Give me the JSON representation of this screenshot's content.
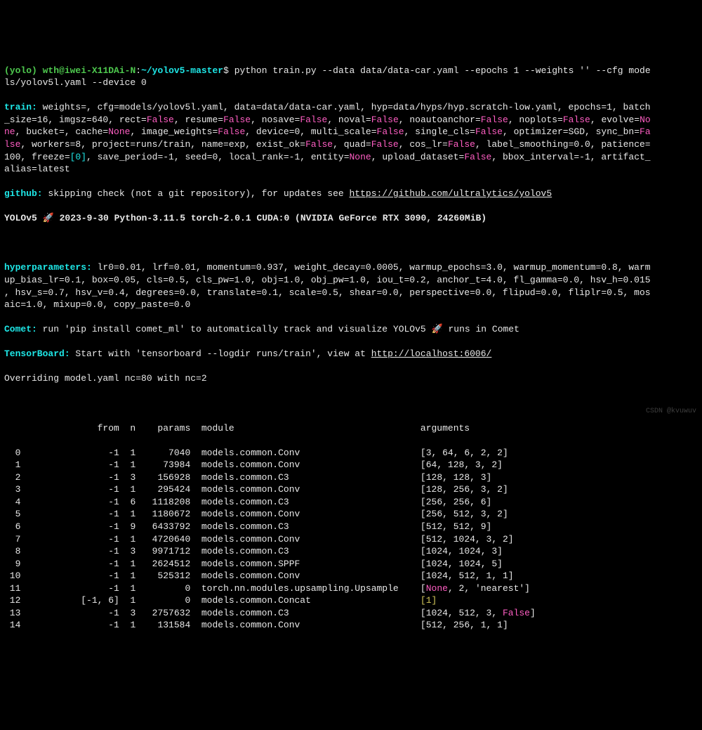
{
  "prompt": {
    "env": "(yolo)",
    "userhost": "wth@iwei-X11DAi-N",
    "path": "~/yolov5-master",
    "dollar": "$",
    "cmd": "python train.py --data data/data-car.yaml --epochs 1 --weights '' --cfg mode\nls/yolov5l.yaml --device 0"
  },
  "train_label": "train:",
  "train_line1": " weights=, cfg=models/yolov5l.yaml, data=data/data-car.yaml, hyp=data/hyps/hyp.scratch-low.yaml, epochs=1, batch\n_size=16, imgsz=640, rect=",
  "false": "False",
  "none": "None",
  "train_resume": ", resume=",
  "train_nosave": ", nosave=",
  "train_noval": ", noval=",
  "train_noauto": ", noautoanchor=",
  "train_noplots": ", noplots=",
  "train_evolve": ", evolve=",
  "train_no": "No",
  "train_ne": "ne",
  "train_bucket": ", bucket=, cache=",
  "train_imgw": ", image_weights=",
  "train_dev": ", device=0, multi_scale=",
  "train_single": ", single_cls=",
  "train_opt": ", optimizer=SGD, sync_bn=",
  "train_fa": "Fa",
  "train_lse": "lse",
  "train_workers": ", workers=8, project=runs/train, name=exp, exist_ok=",
  "train_quad": ", quad=",
  "train_cos": ", cos_lr=",
  "train_label_sm": ", label_smoothing=0.0, patience=\n100, freeze=",
  "train_freeze_val": "[0]",
  "train_save": ", save_period=-1, seed=0, local_rank=-1, entity=",
  "train_upload": ", upload_dataset=",
  "train_bbox": ", bbox_interval=-1, artifact_\nalias=latest",
  "github_label": "github:",
  "github_text": " skipping check (not a git repository), for updates see ",
  "github_url": "https://github.com/ultralytics/yolov5",
  "yolov5_line": "YOLOv5 🚀 2023-9-30 Python-3.11.5 torch-2.0.1 CUDA:0 (NVIDIA GeForce RTX 3090, 24260MiB)",
  "hyper_label": "hyperparameters:",
  "hyper_text": " lr0=0.01, lrf=0.01, momentum=0.937, weight_decay=0.0005, warmup_epochs=3.0, warmup_momentum=0.8, warm\nup_bias_lr=0.1, box=0.05, cls=0.5, cls_pw=1.0, obj=1.0, obj_pw=1.0, iou_t=0.2, anchor_t=4.0, fl_gamma=0.0, hsv_h=0.015\n, hsv_s=0.7, hsv_v=0.4, degrees=0.0, translate=0.1, scale=0.5, shear=0.0, perspective=0.0, flipud=0.0, fliplr=0.5, mos\naic=1.0, mixup=0.0, copy_paste=0.0",
  "comet_label": "Comet:",
  "comet_text": " run 'pip install comet_ml' to automatically track and visualize YOLOv5 🚀 runs in Comet",
  "tb_label": "TensorBoard:",
  "tb_text": " Start with 'tensorboard --logdir runs/train', view at ",
  "tb_url": "http://localhost:6006/",
  "override": "Overriding model.yaml nc=80 with nc=2",
  "table": {
    "header": "                 from  n    params  module                                  arguments",
    "rows": [
      {
        "idx": "  0",
        "from": "                -1",
        "n": "  1",
        "params": "      7040",
        "module": "  models.common.Conv                      ",
        "args": "[3, 64, 6, 2, 2]"
      },
      {
        "idx": "  1",
        "from": "                -1",
        "n": "  1",
        "params": "     73984",
        "module": "  models.common.Conv                      ",
        "args": "[64, 128, 3, 2]"
      },
      {
        "idx": "  2",
        "from": "                -1",
        "n": "  3",
        "params": "    156928",
        "module": "  models.common.C3                        ",
        "args": "[128, 128, 3]"
      },
      {
        "idx": "  3",
        "from": "                -1",
        "n": "  1",
        "params": "    295424",
        "module": "  models.common.Conv                      ",
        "args": "[128, 256, 3, 2]"
      },
      {
        "idx": "  4",
        "from": "                -1",
        "n": "  6",
        "params": "   1118208",
        "module": "  models.common.C3                        ",
        "args": "[256, 256, 6]"
      },
      {
        "idx": "  5",
        "from": "                -1",
        "n": "  1",
        "params": "   1180672",
        "module": "  models.common.Conv                      ",
        "args": "[256, 512, 3, 2]"
      },
      {
        "idx": "  6",
        "from": "                -1",
        "n": "  9",
        "params": "   6433792",
        "module": "  models.common.C3                        ",
        "args": "[512, 512, 9]"
      },
      {
        "idx": "  7",
        "from": "                -1",
        "n": "  1",
        "params": "   4720640",
        "module": "  models.common.Conv                      ",
        "args": "[512, 1024, 3, 2]"
      },
      {
        "idx": "  8",
        "from": "                -1",
        "n": "  3",
        "params": "   9971712",
        "module": "  models.common.C3                        ",
        "args": "[1024, 1024, 3]"
      },
      {
        "idx": "  9",
        "from": "                -1",
        "n": "  1",
        "params": "   2624512",
        "module": "  models.common.SPPF                      ",
        "args": "[1024, 1024, 5]"
      },
      {
        "idx": " 10",
        "from": "                -1",
        "n": "  1",
        "params": "    525312",
        "module": "  models.common.Conv                      ",
        "args": "[1024, 512, 1, 1]"
      },
      {
        "idx": " 11",
        "from": "                -1",
        "n": "  1",
        "params": "         0",
        "module": "  torch.nn.modules.upsampling.Upsample    ",
        "args_special": true,
        "args_pre": "[",
        "args_none": "None",
        "args_post": ", 2, 'nearest']"
      },
      {
        "idx": " 12",
        "from": "           [-1, 6]",
        "n": "  1",
        "params": "         0",
        "module": "  models.common.Concat                    ",
        "args_yellow": "[1]"
      },
      {
        "idx": " 13",
        "from": "                -1",
        "n": "  3",
        "params": "   2757632",
        "module": "  models.common.C3                        ",
        "args_false": true,
        "args_pre": "[1024, 512, 3, ",
        "args_false_val": "False",
        "args_post": "]"
      },
      {
        "idx": " 14",
        "from": "                -1",
        "n": "  1",
        "params": "    131584",
        "module": "  models.common.Conv                      ",
        "args": "[512, 256, 1, 1]"
      }
    ]
  },
  "watermark_right": "CSDN @kvuwuv"
}
